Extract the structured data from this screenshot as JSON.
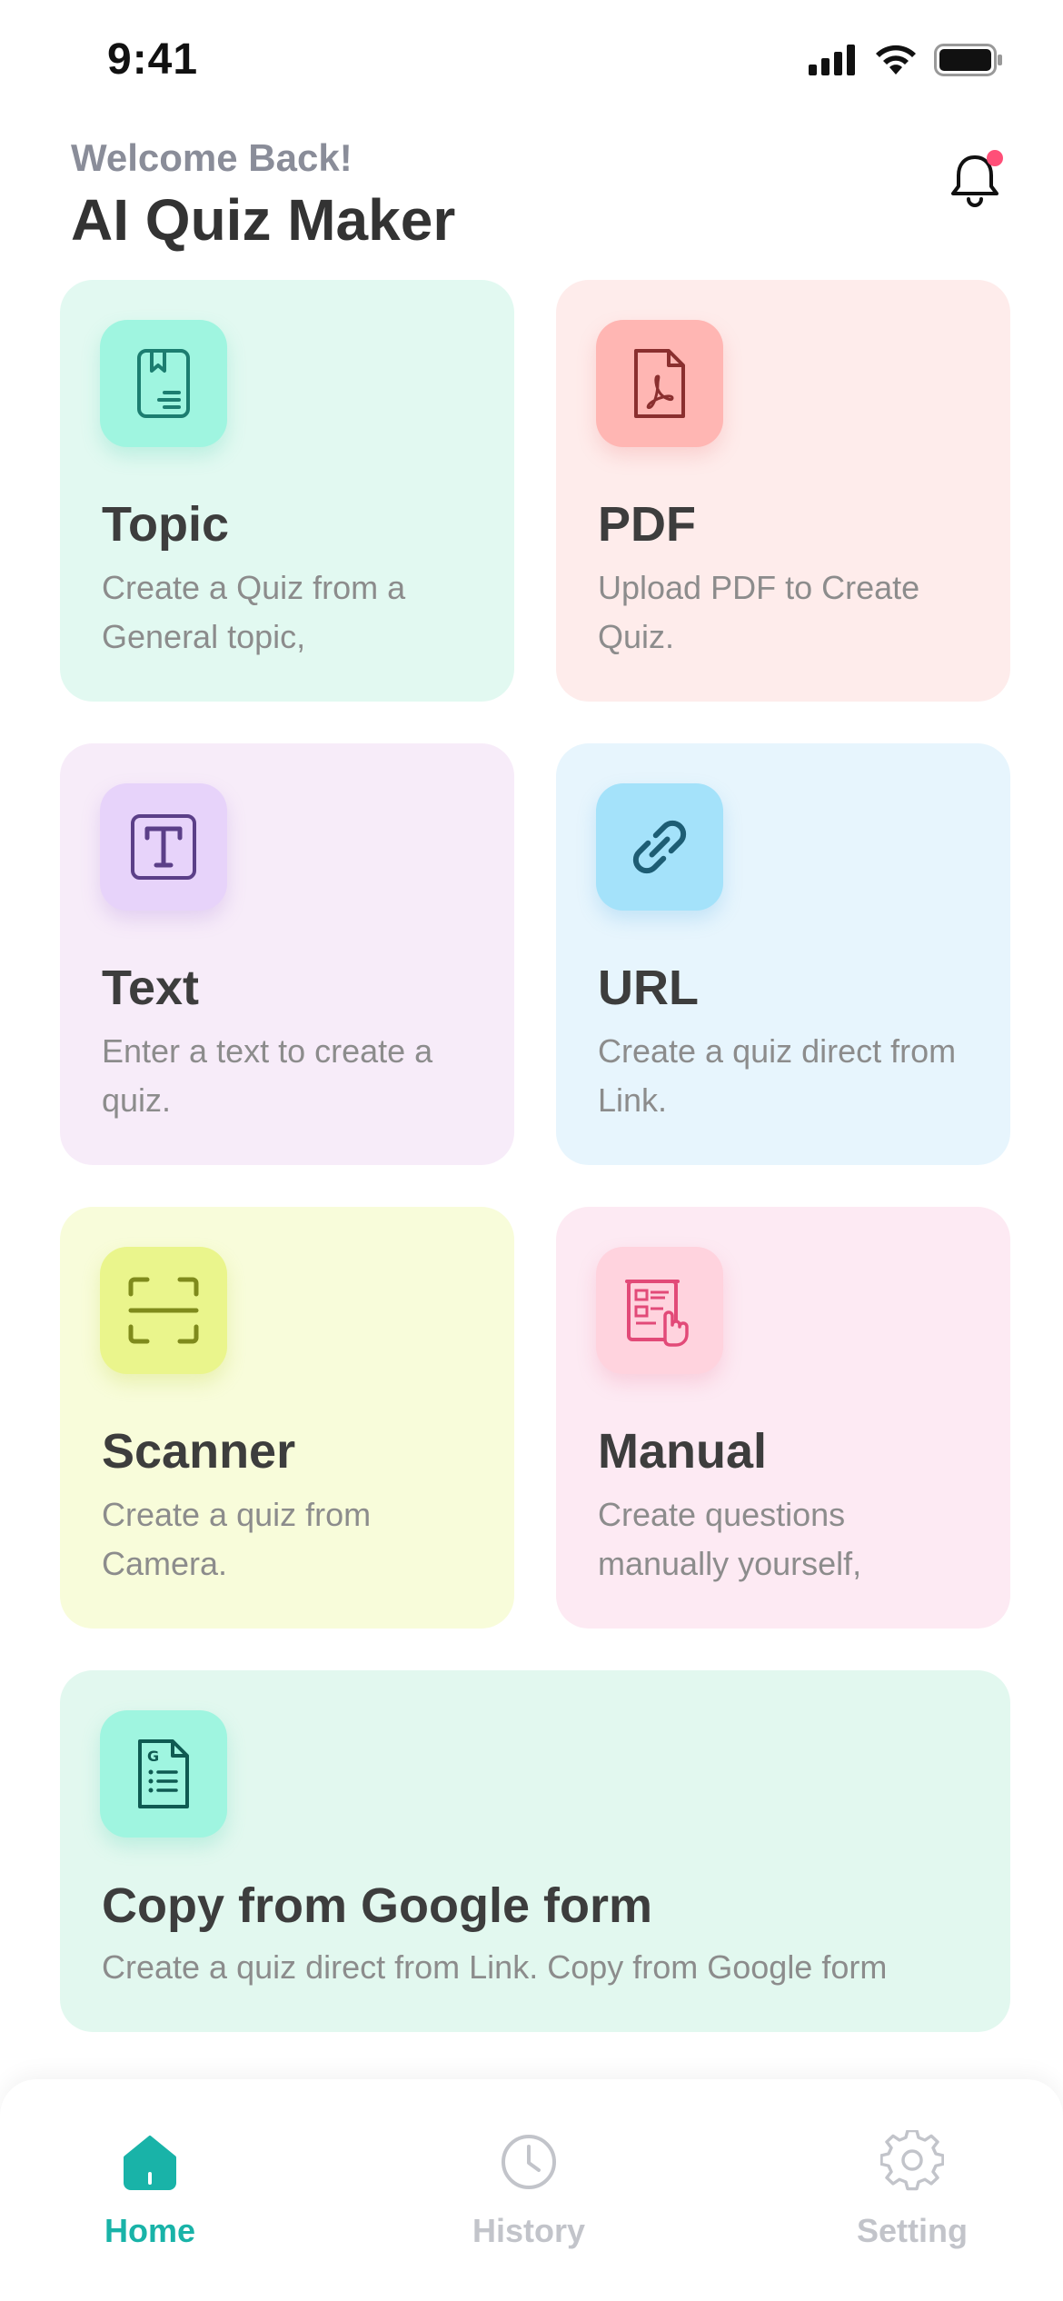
{
  "status_bar": {
    "time": "9:41"
  },
  "header": {
    "welcome": "Welcome Back!",
    "title": "AI Quiz Maker"
  },
  "cards": {
    "topic": {
      "title": "Topic",
      "desc": "Create a Quiz from a General topic,",
      "icon": "bookmark-document-icon"
    },
    "pdf": {
      "title": "PDF",
      "desc": "Upload PDF to Create Quiz.",
      "icon": "pdf-file-icon"
    },
    "text": {
      "title": "Text",
      "desc": "Enter a text to create a quiz.",
      "icon": "text-t-icon"
    },
    "url": {
      "title": "URL",
      "desc": "Create a quiz direct from Link.",
      "icon": "link-icon"
    },
    "scanner": {
      "title": "Scanner",
      "desc": "Create a quiz from Camera.",
      "icon": "scan-frame-icon"
    },
    "manual": {
      "title": "Manual",
      "desc": "Create questions manually yourself,",
      "icon": "manual-document-hand-icon"
    },
    "google": {
      "title": "Copy from Google form",
      "desc": "Create a quiz direct from Link. Copy  from Google form",
      "icon": "google-form-document-icon"
    }
  },
  "nav": {
    "home": "Home",
    "history": "History",
    "setting": "Setting",
    "active": "home"
  },
  "colors": {
    "accent": "#19b3a8",
    "notification_dot": "#ff4f78",
    "title_text": "#333333",
    "muted_text": "#8c8c8c"
  }
}
